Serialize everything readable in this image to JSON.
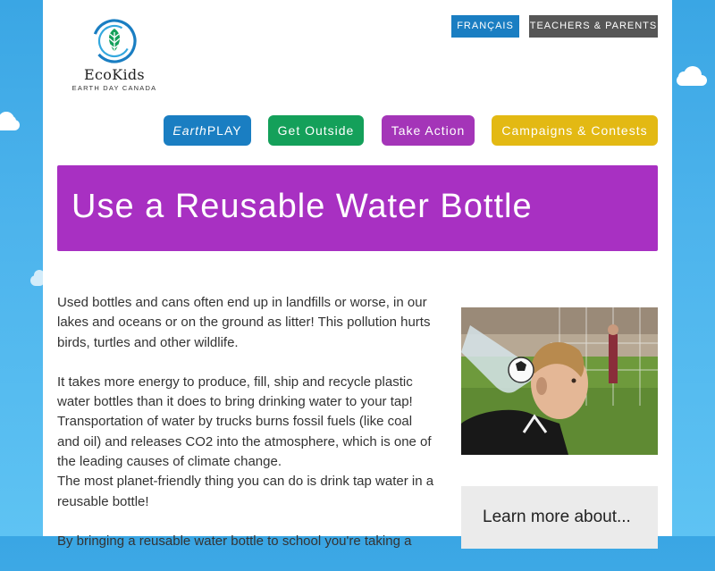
{
  "brand": {
    "name": "EcoKids",
    "tagline": "EARTH DAY CANADA"
  },
  "utility_nav": {
    "francais": "FRANÇAIS",
    "teachers_parents": "TEACHERS & PARENTS"
  },
  "main_nav": {
    "earthplay_prefix": "Earth",
    "earthplay_suffix": "PLAY",
    "get_outside": "Get Outside",
    "take_action": "Take Action",
    "campaigns": "Campaigns & Contests"
  },
  "page": {
    "title": "Use a Reusable Water Bottle"
  },
  "content": {
    "paragraphs": [
      "Used bottles and cans often end up in landfills or worse, in our lakes and oceans or on the ground as litter! This pollution hurts birds, turtles and other wildlife.",
      "It takes more energy to produce, fill, ship and recycle plastic water bottles than it does to bring drinking water to your tap! Transportation of water by trucks burns fossil fuels (like coal and oil) and releases CO2 into the atmosphere, which is one of the leading causes of climate change.",
      "The most planet-friendly thing you can do is drink tap water in a reusable bottle!",
      "By bringing a reusable water bottle to school you're taking a"
    ]
  },
  "sidebar": {
    "learn_more": "Learn more about..."
  },
  "colors": {
    "sky": "#4cb3ec",
    "blue": "#1a7ec2",
    "green": "#14a05a",
    "purple": "#a435b8",
    "yellow": "#e3b913",
    "gray": "#565656",
    "banner": "#a830c2"
  },
  "icons": {
    "logo": "leaf-circle-icon"
  }
}
